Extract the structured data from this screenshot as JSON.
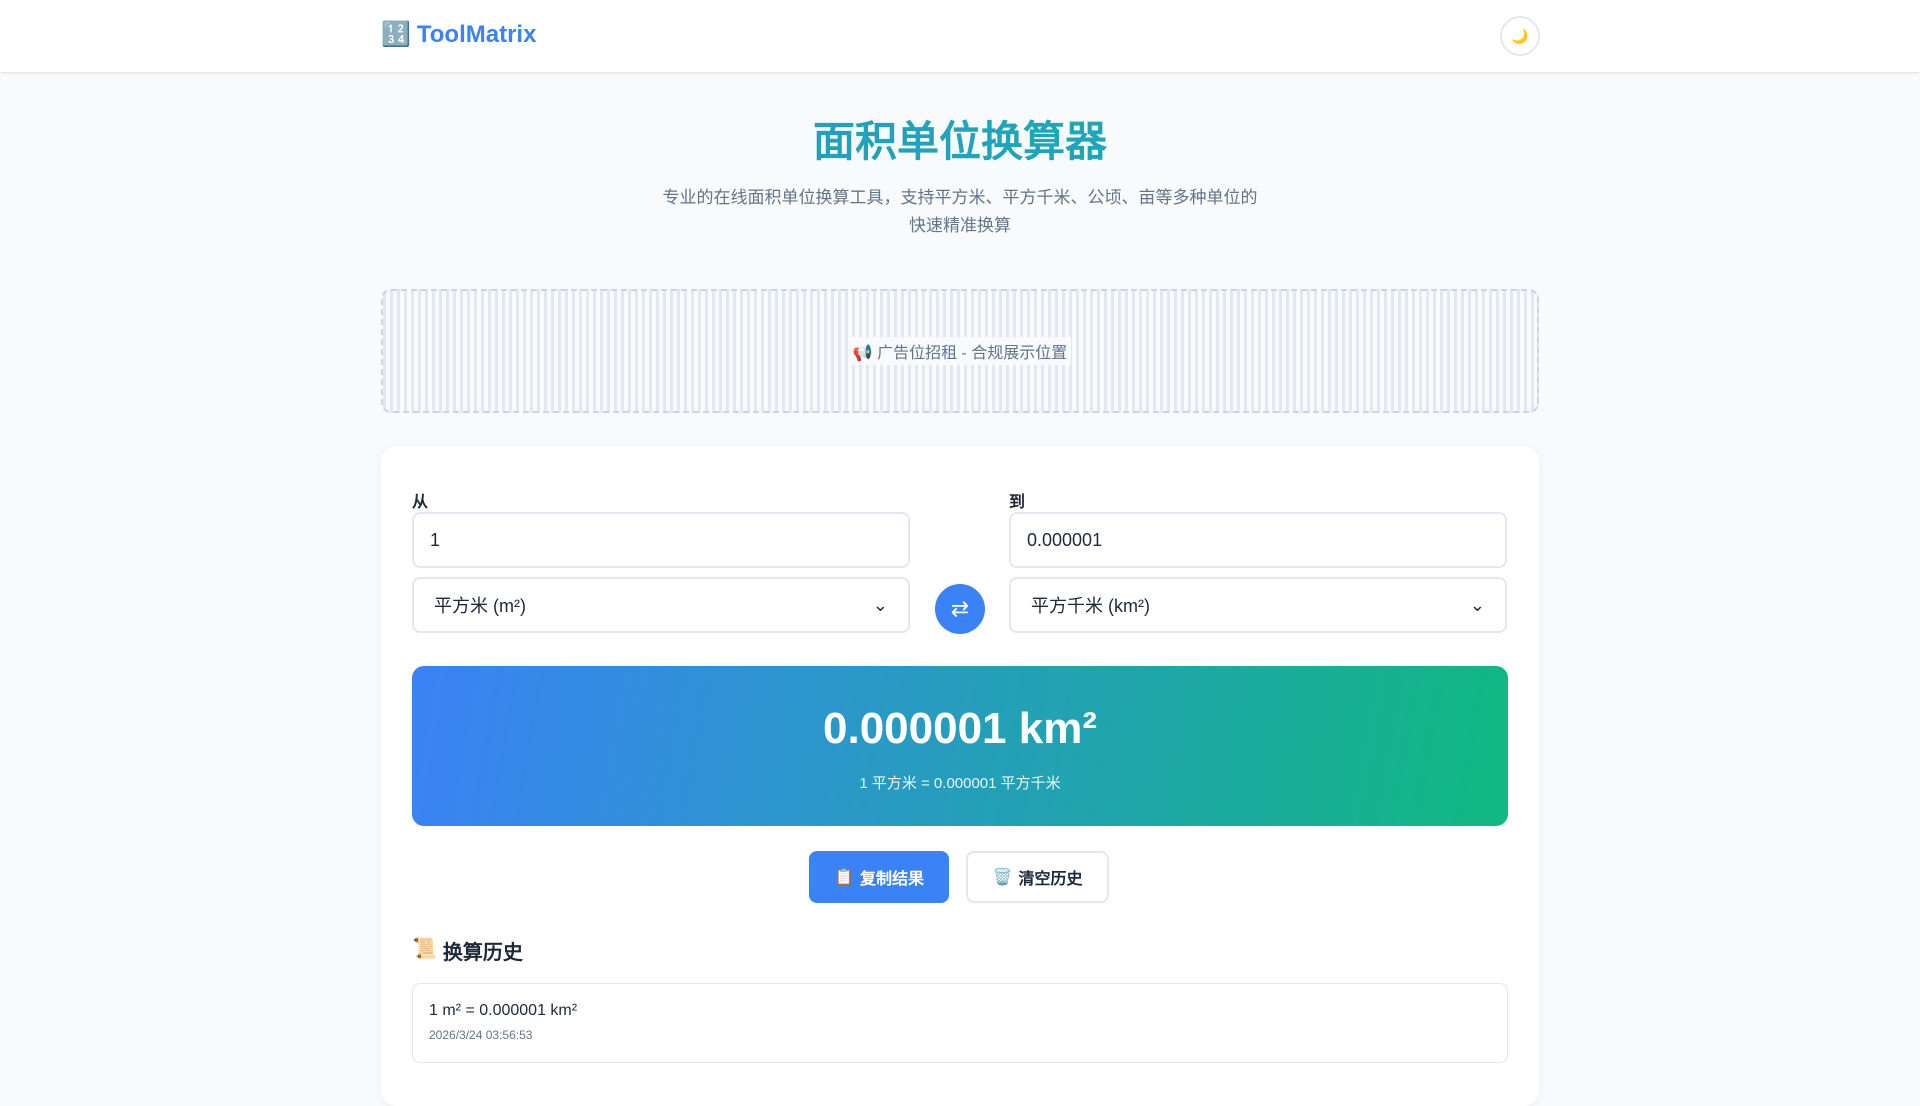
{
  "header": {
    "logo_icon": "🔢",
    "logo_text": "ToolMatrix",
    "theme_icon": "🌙"
  },
  "page": {
    "title": "面积单位换算器",
    "subtitle": "专业的在线面积单位换算工具，支持平方米、平方千米、公顷、亩等多种单位的快速精准换算"
  },
  "ad": {
    "text": "📢 广告位招租 - 合规展示位置"
  },
  "converter": {
    "from_label": "从",
    "to_label": "到",
    "from_value": "1",
    "to_value": "0.000001",
    "from_unit": "平方米 (m²)",
    "to_unit": "平方千米 (km²)",
    "swap_icon": "⇄"
  },
  "result": {
    "main": "0.000001 km²",
    "formula": "1 平方米 = 0.000001 平方千米"
  },
  "actions": {
    "copy_icon": "📋",
    "copy_label": "复制结果",
    "clear_icon": "🗑️",
    "clear_label": "清空历史"
  },
  "history": {
    "icon": "📜",
    "title": "换算历史",
    "items": [
      {
        "expr": "1 m² = 0.000001 km²",
        "time": "2026/3/24 03:56:53"
      }
    ]
  }
}
